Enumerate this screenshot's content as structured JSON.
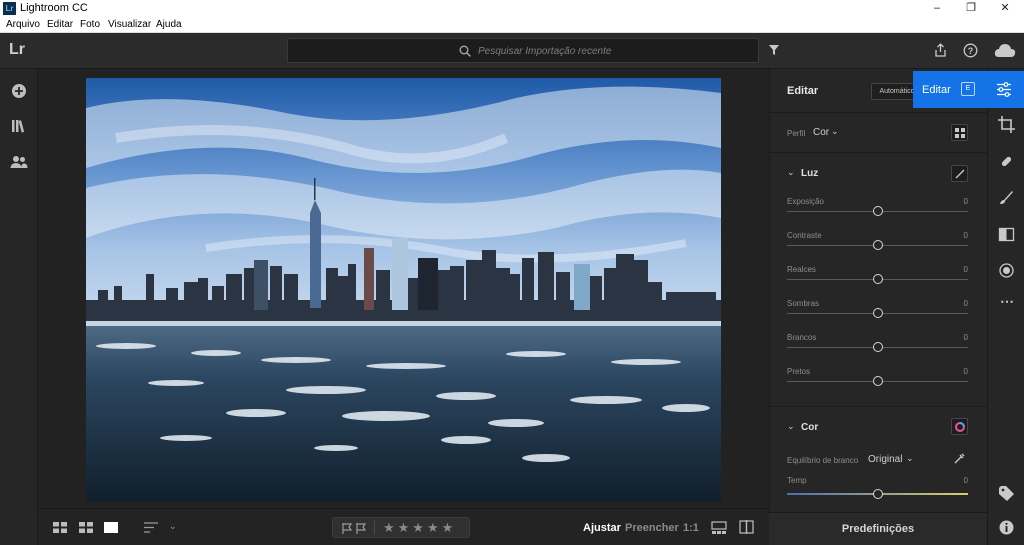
{
  "window": {
    "title": "Lightroom CC",
    "app_icon_text": "Lr",
    "controls": [
      "minimize",
      "maximize",
      "close"
    ]
  },
  "menu": [
    "Arquivo",
    "Editar",
    "Foto",
    "Visualizar",
    "Ajuda"
  ],
  "toolbar": {
    "logo": "Lr",
    "search_placeholder": "Pesquisar Importação recente",
    "icons": [
      "filter-icon",
      "share-icon",
      "help-icon",
      "cloud-icon"
    ]
  },
  "left_rail": {
    "icons": [
      "add-photos-icon",
      "library-icon",
      "people-icon"
    ]
  },
  "photo": {
    "description_icon": "photo-nyc-skyline"
  },
  "bottom_bar": {
    "view_icons": [
      "square-grid-icon",
      "photo-grid-icon",
      "detail-icon"
    ],
    "sort_icon": "sort-icon",
    "flags": [
      "pick-flag-icon",
      "reject-flag-icon"
    ],
    "stars": 5,
    "fit": "Ajustar",
    "fill": "Preencher",
    "ratio": "1:1",
    "compare_icons": [
      "versions-icon",
      "compare-icon"
    ]
  },
  "edit_panel": {
    "title": "Editar",
    "auto_button": "Automático",
    "profile_label": "Perfil",
    "profile_value": "Cor",
    "light": {
      "title": "Luz",
      "sliders": [
        {
          "label": "Exposição",
          "value": "0"
        },
        {
          "label": "Contraste",
          "value": "0"
        },
        {
          "label": "Realces",
          "value": "0"
        },
        {
          "label": "Sombras",
          "value": "0"
        },
        {
          "label": "Brancos",
          "value": "0"
        },
        {
          "label": "Pretos",
          "value": "0"
        }
      ]
    },
    "color": {
      "title": "Cor",
      "wb_label": "Equilíbrio de branco",
      "wb_value": "Original",
      "temp_label": "Temp",
      "temp_value": "0"
    },
    "presets": "Predefinições"
  },
  "edit_tooltip": {
    "label": "Editar",
    "shortcut": "E"
  },
  "right_strip": {
    "icons": [
      "crop-icon",
      "healing-icon",
      "brush-icon",
      "linear-gradient-icon",
      "radial-gradient-icon",
      "more-icon",
      "tag-icon",
      "info-icon"
    ]
  },
  "colors": {
    "accent": "#1473e6",
    "panel": "#262626",
    "background": "#1e1e1e"
  }
}
